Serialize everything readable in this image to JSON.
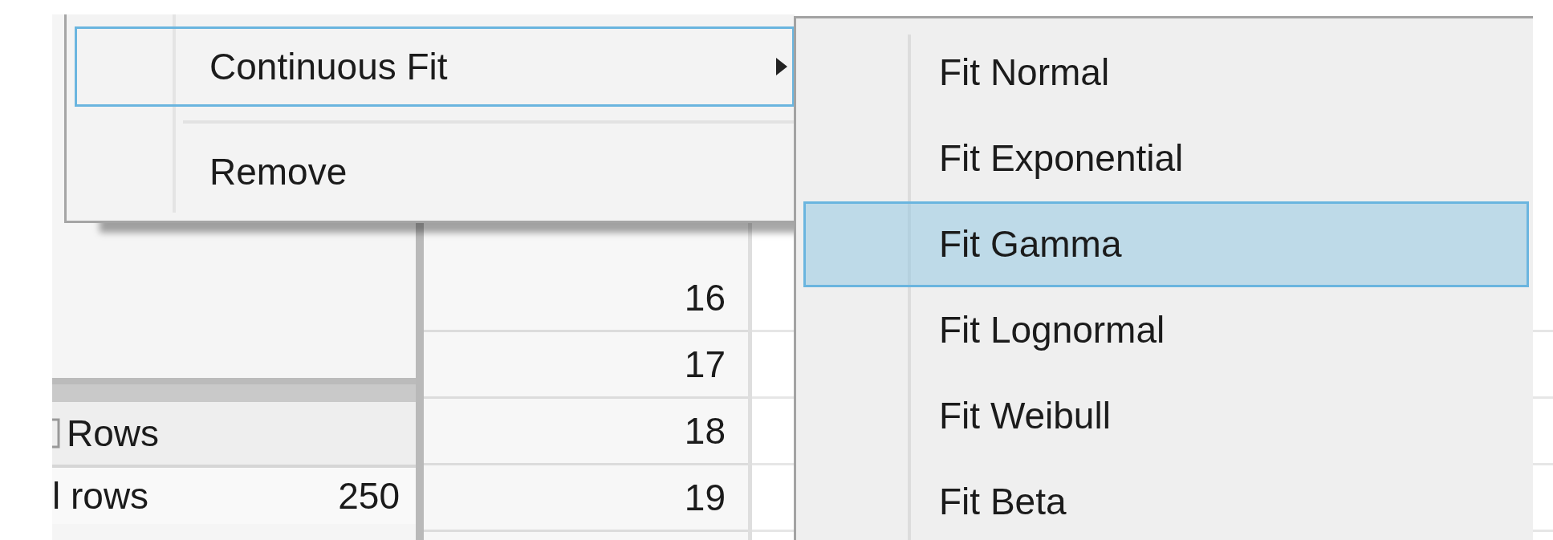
{
  "rows_panel": {
    "title": "Rows",
    "rows": [
      {
        "label": "l rows",
        "value": "250"
      }
    ]
  },
  "table": {
    "row_numbers": [
      "16",
      "17",
      "18",
      "19"
    ]
  },
  "context_menu": {
    "items": [
      {
        "kind": "submenu",
        "label": "Continuous Fit",
        "selected": true
      },
      {
        "kind": "separator"
      },
      {
        "kind": "item",
        "label": "Remove",
        "selected": false
      }
    ]
  },
  "submenu": {
    "items": [
      {
        "label": "Fit Normal",
        "selected": false
      },
      {
        "label": "Fit Exponential",
        "selected": false
      },
      {
        "label": "Fit Gamma",
        "selected": true
      },
      {
        "label": "Fit Lognormal",
        "selected": false
      },
      {
        "label": "Fit Weibull",
        "selected": false
      },
      {
        "label": "Fit Beta",
        "selected": false
      }
    ]
  }
}
